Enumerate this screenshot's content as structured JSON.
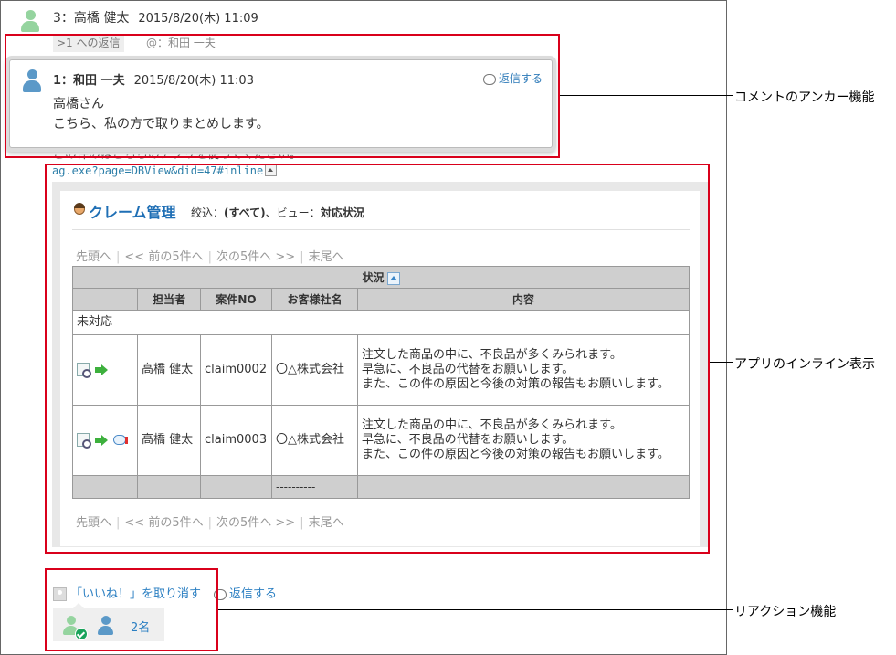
{
  "comment3": {
    "header": "3：高橋 健太",
    "date": "2015/8/20(木) 11:09",
    "reply_tag": ">1 への返信",
    "mention": "@：和田 一夫",
    "hidden_body": "この件のはこちらのアプリを使ってください。"
  },
  "popup": {
    "header": "1：和田 一夫",
    "date": "2015/8/20(木) 11:03",
    "reply_label": "返信する",
    "lines": [
      "高橋さん",
      "こちら、私の方で取りまとめします。"
    ]
  },
  "inline": {
    "url": "ag.exe?page=DBView&did=47#inline",
    "app_title": "クレーム管理",
    "filter_label": "絞込：",
    "filter_value": "(すべて)",
    "view_label": "、ビュー：",
    "view_value": "対応状況",
    "pager": {
      "first": "先頭へ",
      "prev": "<< 前の5件へ",
      "next": "次の5件へ >>",
      "last": "末尾へ"
    },
    "group_header": "状況",
    "columns": [
      "",
      "担当者",
      "案件NO",
      "お客様社名",
      "内容"
    ],
    "group_value": "未対応",
    "rows": [
      {
        "owner": "高橋 健太",
        "case_no": "claim0002",
        "company": "〇△株式会社",
        "content": [
          "注文した商品の中に、不良品が多くみられます。",
          "早急に、不良品の代替をお願いします。",
          "また、この件の原因と今後の対策の報告もお願いします。"
        ]
      },
      {
        "owner": "高橋 健太",
        "case_no": "claim0003",
        "company": "〇△株式会社",
        "content": [
          "注文した商品の中に、不良品が多くみられます。",
          "早急に、不良品の代替をお願いします。",
          "また、この件の原因と今後の対策の報告もお願いします。"
        ]
      }
    ],
    "footer_company": "----------"
  },
  "reaction": {
    "undo_label": "「いいね！」を取り消す",
    "reply_label": "返信する",
    "count": "2名"
  },
  "annotations": {
    "anchor": "コメントのアンカー機能",
    "inline": "アプリのインライン表示",
    "reaction": "リアクション機能"
  },
  "colors": {
    "callout": "#d9001b",
    "link": "#2b7fc2",
    "title": "#1f6fb5"
  }
}
